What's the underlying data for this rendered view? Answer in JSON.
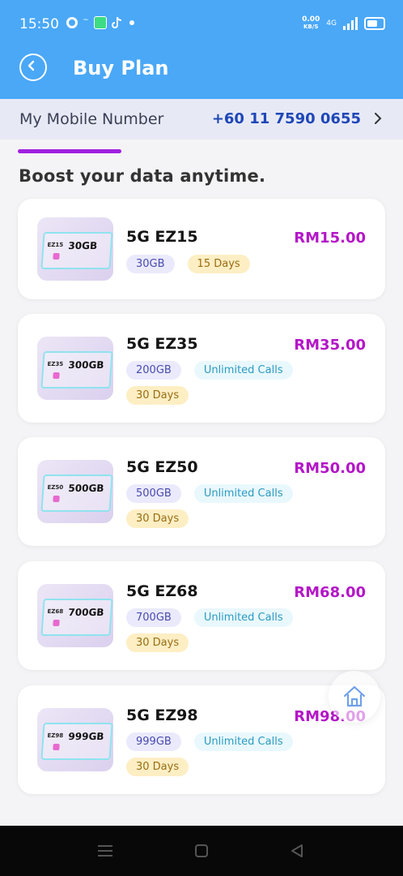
{
  "status": {
    "time": "15:50",
    "speed": "0.00",
    "speed_unit": "KB/S",
    "network": "4G"
  },
  "header": {
    "title": "Buy Plan"
  },
  "number_row": {
    "label": "My Mobile Number",
    "value": "+60 11 7590 0655"
  },
  "section": {
    "heading": "Boost your data anytime."
  },
  "plans": [
    {
      "name": "5G EZ15",
      "price": "RM15.00",
      "sim_code": "EZ15",
      "sim_data": "30GB",
      "tags": {
        "data": "30GB",
        "days": "15 Days"
      }
    },
    {
      "name": "5G EZ35",
      "price": "RM35.00",
      "sim_code": "EZ35",
      "sim_data": "300GB",
      "tags": {
        "data": "200GB",
        "calls": "Unlimited Calls",
        "days": "30 Days"
      }
    },
    {
      "name": "5G EZ50",
      "price": "RM50.00",
      "sim_code": "EZ50",
      "sim_data": "500GB",
      "tags": {
        "data": "500GB",
        "calls": "Unlimited Calls",
        "days": "30 Days"
      }
    },
    {
      "name": "5G EZ68",
      "price": "RM68.00",
      "sim_code": "EZ68",
      "sim_data": "700GB",
      "tags": {
        "data": "700GB",
        "calls": "Unlimited Calls",
        "days": "30 Days"
      }
    },
    {
      "name": "5G EZ98",
      "price": "RM98.00",
      "sim_code": "EZ98",
      "sim_data": "999GB",
      "tags": {
        "data": "999GB",
        "calls": "Unlimited Calls",
        "days": "30 Days"
      }
    }
  ],
  "colors": {
    "header_bg": "#4aa8f7",
    "accent_price": "#b416c8",
    "number_text": "#1f47b8",
    "tab_indicator": "#a020e0"
  },
  "icons": {
    "back": "back-arrow-circle-icon",
    "chevron": "chevron-right-icon",
    "home": "home-icon"
  }
}
